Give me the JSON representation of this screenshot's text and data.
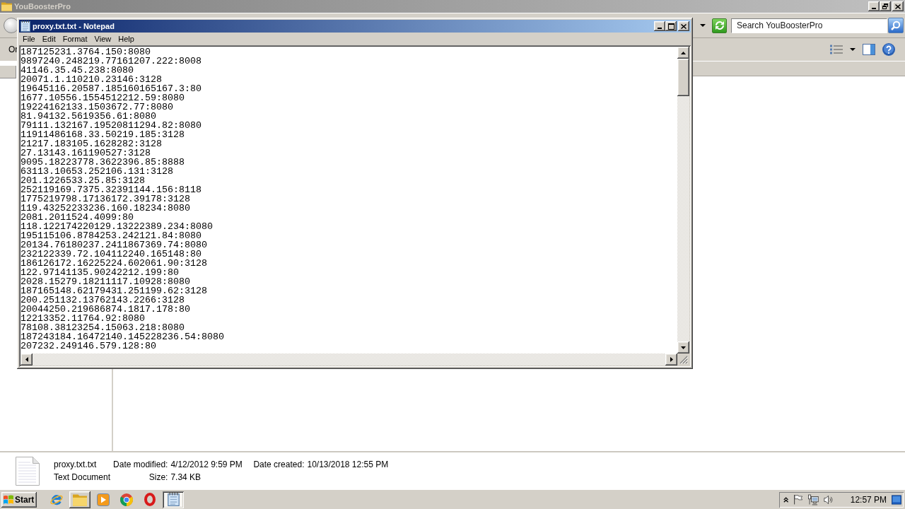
{
  "explorer": {
    "title": "YouBoosterPro",
    "active": false,
    "maximized": true,
    "search": {
      "placeholder": "Search YouBoosterPro"
    },
    "toolbar": {
      "menu_label": "Or"
    },
    "details": {
      "file_name": "proxy.txt.txt",
      "file_type": "Text Document",
      "properties": [
        {
          "label": "Date modified:",
          "value": "4/12/2012 9:59 PM"
        },
        {
          "label": "Date created:",
          "value": "10/13/2018 12:55 PM"
        },
        {
          "label": "Size:",
          "value": "7.34 KB"
        }
      ]
    }
  },
  "notepad": {
    "title": "proxy.txt.txt - Notepad",
    "active": true,
    "maximized": false,
    "menu": [
      "File",
      "Edit",
      "Format",
      "View",
      "Help"
    ],
    "lines": [
      "187125231.3764.150:8080",
      "9897240.248219.77161207.222:8008",
      "41146.35.45.238:8080",
      "20071.1.110210.23146:3128",
      "19645116.20587.185160165167.3:80",
      "1677.10556.1554512212.59:8080",
      "19224162133.1503672.77:8080",
      "81.94132.5619356.61:8080",
      "79111.132167.19520811294.82:8080",
      "11911486168.33.50219.185:3128",
      "21217.183105.1628282:3128",
      "27.13143.161190527:3128",
      "9095.18223778.3622396.85:8888",
      "63113.10653.252106.131:3128",
      "201.1226533.25.85:3128",
      "252119169.7375.32391144.156:8118",
      "1775219798.17136172.39178:3128",
      "119.43252233236.160.18234:8080",
      "2081.2011524.4099:80",
      "118.122174220129.13222389.234:8080",
      "195115106.8784253.242121.84:8080",
      "20134.76180237.2411867369.74:8080",
      "232122339.72.104112240.165148:80",
      "186126172.16225224.602061.90:3128",
      "122.97141135.90242212.199:80",
      "2028.15279.18211117.10928:8080",
      "187165148.62179431.251199.62:3128",
      "200.251132.13762143.2266:3128",
      "20044250.219686874.1817.178:80",
      "12213352.11764.92:8080",
      "78108.38123254.15063.218:8080",
      "187243184.16472140.145228236.54:8080",
      "207232.249146.579.128:80"
    ]
  },
  "taskbar": {
    "start": "Start",
    "apps": [
      {
        "kind": "browser",
        "open": false,
        "selected": false
      },
      {
        "kind": "folder",
        "open": true,
        "selected": false
      },
      {
        "kind": "media",
        "open": false,
        "selected": false
      },
      {
        "kind": "wheel",
        "open": false,
        "selected": false
      },
      {
        "kind": "ring",
        "open": false,
        "selected": false
      },
      {
        "kind": "notepad",
        "open": true,
        "selected": true
      }
    ],
    "clock": "12:57 PM"
  }
}
